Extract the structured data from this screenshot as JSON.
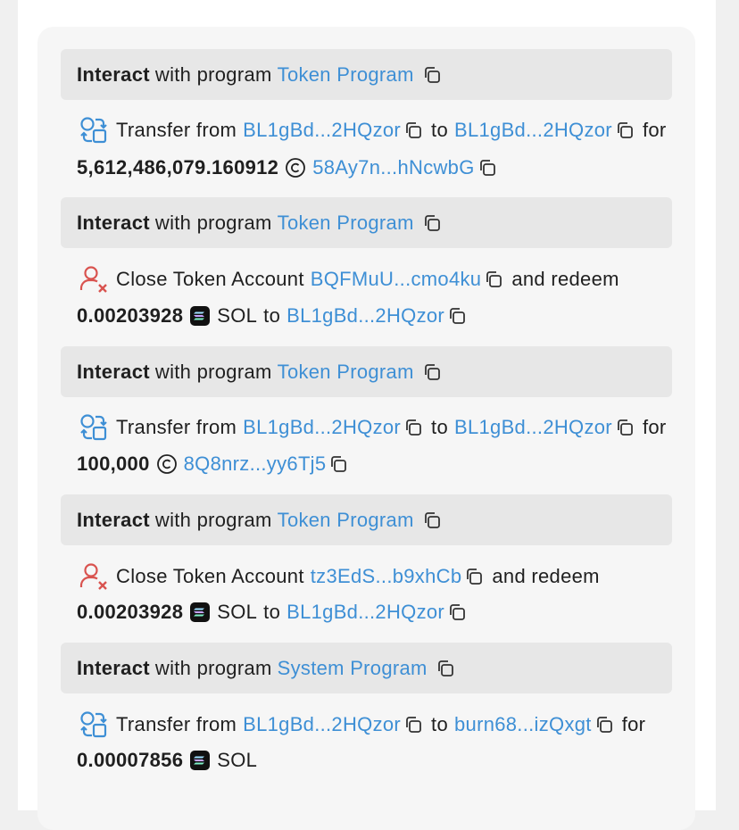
{
  "instructions": [
    {
      "header": {
        "keyword": "Interact",
        "text": "with program",
        "program": "Token Program"
      },
      "action": {
        "verb": "Transfer from",
        "from": "BL1gBd...2HQzor",
        "to_word": "to",
        "to": "BL1gBd...2HQzor",
        "for_word": "for"
      },
      "detail": {
        "amount": "5,612,486,079.160912",
        "token": "58Ay7n...hNcwbG"
      }
    },
    {
      "header": {
        "keyword": "Interact",
        "text": "with program",
        "program": "Token Program"
      },
      "action": {
        "verb": "Close Token Account",
        "account": "BQFMuU...cmo4ku",
        "suffix": "and redeem"
      },
      "detail": {
        "amount": "0.00203928",
        "token": "SOL",
        "to_word": "to",
        "to": "BL1gBd...2HQzor"
      }
    },
    {
      "header": {
        "keyword": "Interact",
        "text": "with program",
        "program": "Token Program"
      },
      "action": {
        "verb": "Transfer from",
        "from": "BL1gBd...2HQzor",
        "to_word": "to",
        "to": "BL1gBd...2HQzor",
        "for_word": "for"
      },
      "detail": {
        "amount": "100,000",
        "token": "8Q8nrz...yy6Tj5"
      }
    },
    {
      "header": {
        "keyword": "Interact",
        "text": "with program",
        "program": "Token Program"
      },
      "action": {
        "verb": "Close Token Account",
        "account": "tz3EdS...b9xhCb",
        "suffix": "and redeem"
      },
      "detail": {
        "amount": "0.00203928",
        "token": "SOL",
        "to_word": "to",
        "to": "BL1gBd...2HQzor"
      }
    },
    {
      "header": {
        "keyword": "Interact",
        "text": "with program",
        "program": "System Program"
      },
      "action": {
        "verb": "Transfer from",
        "from": "BL1gBd...2HQzor",
        "to_word": "to",
        "to": "burn68...izQxgt",
        "for_word": "for"
      },
      "detail": {
        "amount": "0.00007856",
        "token": "SOL"
      }
    }
  ],
  "colors": {
    "link": "#3e8fd5",
    "header_bg": "#e7e7e7",
    "card_bg": "#f6f6f6",
    "transfer_icon": "#3e8fd5",
    "close_icon": "#d9534f"
  },
  "icons": {
    "copy": "copy-icon",
    "transfer": "transfer-icon",
    "close_account": "close-account-icon",
    "coin": "coin-icon",
    "sol": "sol-icon"
  }
}
